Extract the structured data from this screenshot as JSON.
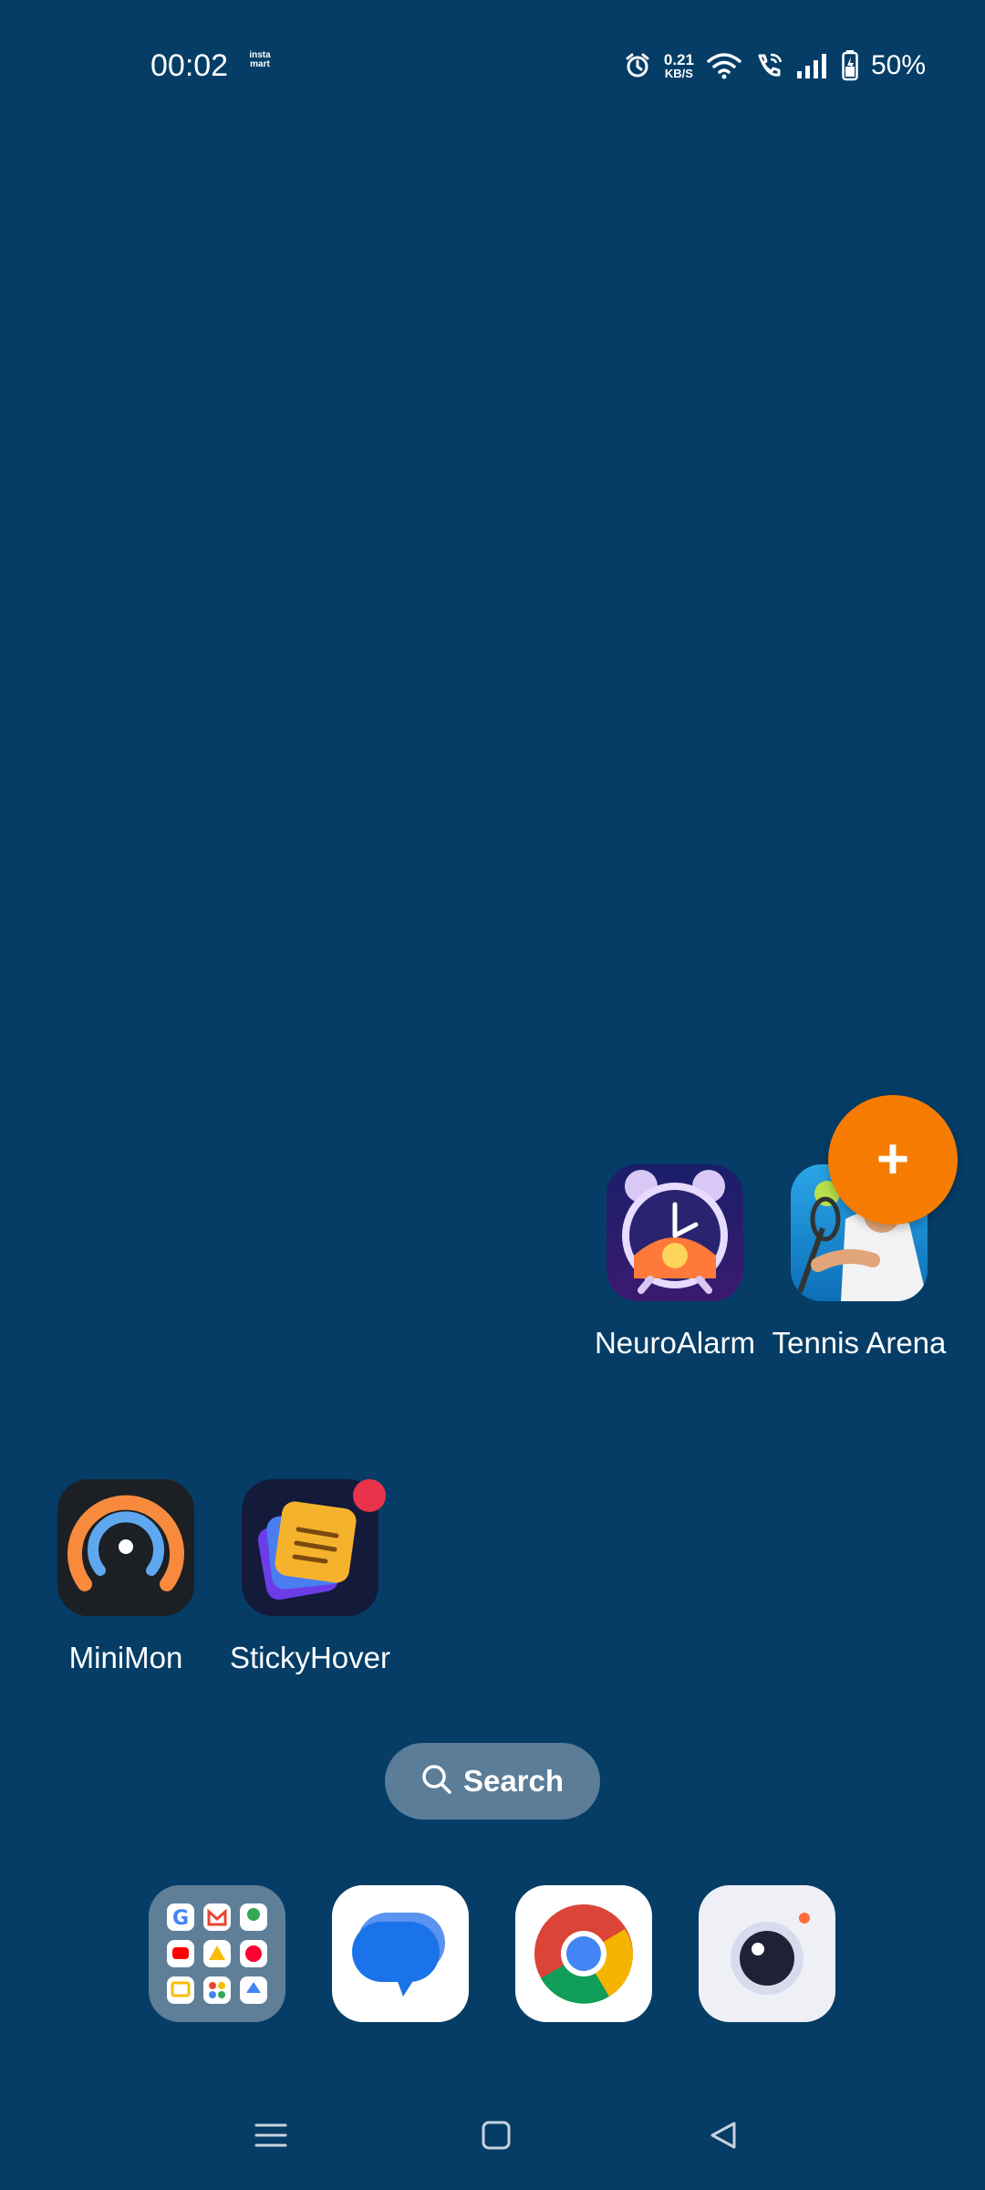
{
  "status_bar": {
    "time": "00:02",
    "notification_icon": "instamart-icon",
    "notification_text": "insta mart",
    "net_speed_value": "0.21",
    "net_speed_unit": "KB/S",
    "battery_percent": "50%",
    "icons": [
      "alarm-icon",
      "wifi-icon",
      "wifi-call-icon",
      "signal-icon",
      "battery-charging-icon"
    ]
  },
  "home": {
    "apps": [
      {
        "label": "NeuroAlarm",
        "icon": "neuroalarm-app-icon"
      },
      {
        "label": "Tennis Arena",
        "icon": "tennis-arena-app-icon"
      },
      {
        "label": "MiniMon",
        "icon": "minimon-app-icon"
      },
      {
        "label": "StickyHover",
        "icon": "stickyhover-app-icon",
        "badge": true
      }
    ],
    "fab": {
      "label": "+",
      "color": "#f57c00"
    },
    "search": {
      "label": "Search",
      "icon": "search-icon"
    }
  },
  "dock": {
    "items": [
      {
        "name": "google-apps-folder",
        "icon": "google-folder-icon"
      },
      {
        "name": "messages",
        "icon": "messages-icon"
      },
      {
        "name": "chrome",
        "icon": "chrome-icon"
      },
      {
        "name": "camera",
        "icon": "camera-icon"
      }
    ]
  },
  "nav": {
    "buttons": [
      "menu-icon",
      "home-icon",
      "back-icon"
    ]
  },
  "colors": {
    "wallpaper": "#053d66",
    "fab": "#f57c00",
    "badge": "#e8334a",
    "search_pill": "#5b7d98"
  }
}
